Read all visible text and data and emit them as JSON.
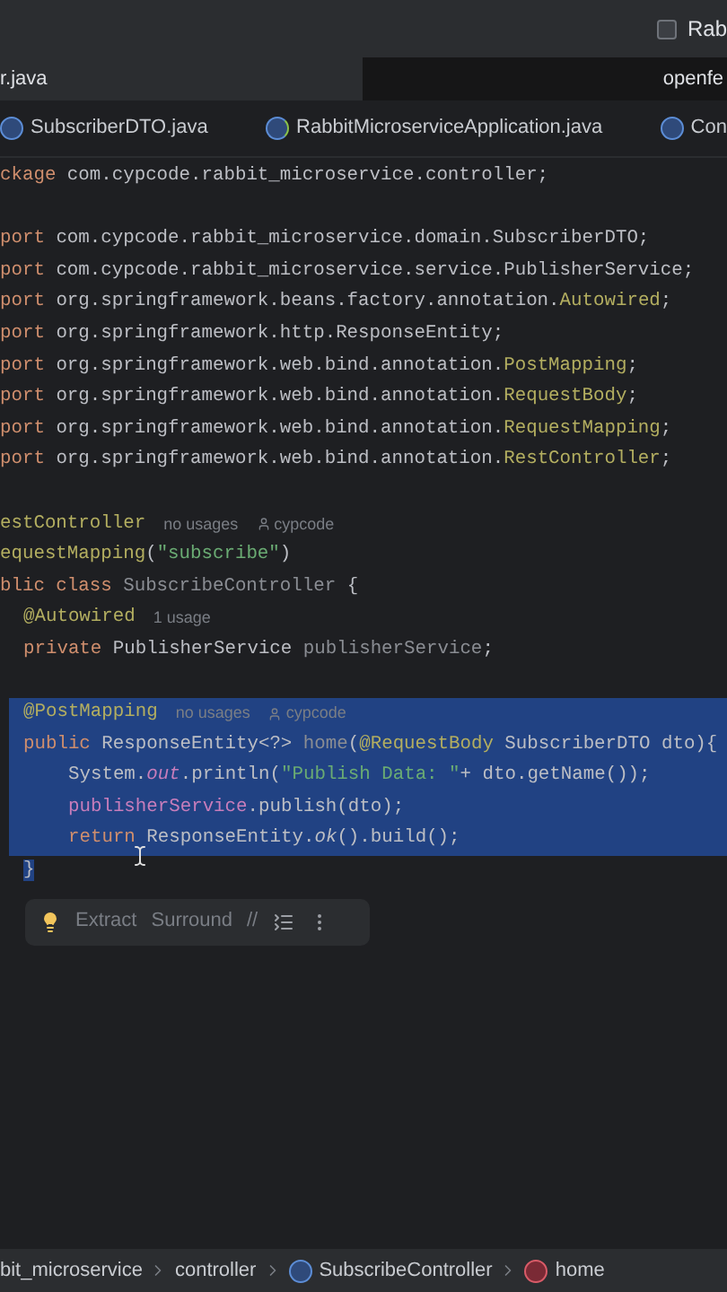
{
  "title_bar": {
    "project": "Rab"
  },
  "editor_tabs": [
    {
      "label": "r.java",
      "selected": true
    },
    {
      "label": "openfe",
      "selected": false
    }
  ],
  "file_tabs": [
    {
      "label": "SubscriberDTO.java",
      "kind": "class"
    },
    {
      "label": "RabbitMicroserviceApplication.java",
      "kind": "app"
    },
    {
      "label": "Con",
      "kind": "class"
    }
  ],
  "code_lines": [
    {
      "kind": "top",
      "selected": false,
      "code": [
        {
          "kind": "keyword",
          "text": "ckage"
        },
        {
          "kind": "plain",
          "text": " com.cypcode.rabbit_microservice.controller;"
        }
      ]
    },
    {
      "kind": "blank",
      "selected": false
    },
    {
      "kind": "top",
      "selected": false,
      "code": [
        {
          "kind": "keyword",
          "text": "port"
        },
        {
          "kind": "plain",
          "text": " com.cypcode.rabbit_microservice.domain.SubscriberDTO;"
        }
      ]
    },
    {
      "kind": "top",
      "selected": false,
      "code": [
        {
          "kind": "keyword",
          "text": "port"
        },
        {
          "kind": "plain",
          "text": " com.cypcode.rabbit_microservice.service.PublisherService;"
        }
      ]
    },
    {
      "kind": "top",
      "selected": false,
      "code": [
        {
          "kind": "keyword",
          "text": "port"
        },
        {
          "kind": "plain",
          "text": " org.springframework.beans.factory.annotation."
        },
        {
          "kind": "annotation",
          "text": "Autowired"
        },
        {
          "kind": "plain",
          "text": ";"
        }
      ]
    },
    {
      "kind": "top",
      "selected": false,
      "code": [
        {
          "kind": "keyword",
          "text": "port"
        },
        {
          "kind": "plain",
          "text": " org.springframework.http.ResponseEntity;"
        }
      ]
    },
    {
      "kind": "top",
      "selected": false,
      "code": [
        {
          "kind": "keyword",
          "text": "port"
        },
        {
          "kind": "plain",
          "text": " org.springframework.web.bind.annotation."
        },
        {
          "kind": "annotation",
          "text": "PostMapping"
        },
        {
          "kind": "plain",
          "text": ";"
        }
      ]
    },
    {
      "kind": "top",
      "selected": false,
      "code": [
        {
          "kind": "keyword",
          "text": "port"
        },
        {
          "kind": "plain",
          "text": " org.springframework.web.bind.annotation."
        },
        {
          "kind": "annotation",
          "text": "RequestBody"
        },
        {
          "kind": "plain",
          "text": ";"
        }
      ]
    },
    {
      "kind": "top",
      "selected": false,
      "code": [
        {
          "kind": "keyword",
          "text": "port"
        },
        {
          "kind": "plain",
          "text": " org.springframework.web.bind.annotation."
        },
        {
          "kind": "annotation",
          "text": "RequestMapping"
        },
        {
          "kind": "plain",
          "text": ";"
        }
      ]
    },
    {
      "kind": "top",
      "selected": false,
      "code": [
        {
          "kind": "keyword",
          "text": "port"
        },
        {
          "kind": "plain",
          "text": " org.springframework.web.bind.annotation."
        },
        {
          "kind": "annotation",
          "text": "RestController"
        },
        {
          "kind": "plain",
          "text": ";"
        }
      ]
    },
    {
      "kind": "blank",
      "selected": false
    },
    {
      "kind": "top",
      "selected": false,
      "code": [
        {
          "kind": "annotation",
          "text": "estController"
        }
      ],
      "hints": [
        {
          "kind": "usage",
          "text": "no usages"
        },
        {
          "kind": "author",
          "text": "cypcode"
        }
      ]
    },
    {
      "kind": "top",
      "selected": false,
      "code": [
        {
          "kind": "annotation",
          "text": "equestMapping"
        },
        {
          "kind": "plain",
          "text": "("
        },
        {
          "kind": "string",
          "text": "\"subscribe\""
        },
        {
          "kind": "plain",
          "text": ")"
        }
      ]
    },
    {
      "kind": "top",
      "selected": false,
      "code": [
        {
          "kind": "keyword",
          "text": "blic class"
        },
        {
          "kind": "unused",
          "text": " SubscribeController"
        },
        {
          "kind": "plain",
          "text": " {"
        }
      ]
    },
    {
      "kind": "member",
      "selected": false,
      "code": [
        {
          "kind": "annotation",
          "text": "@Autowired"
        }
      ],
      "hints": [
        {
          "kind": "usage",
          "text": "1 usage"
        }
      ]
    },
    {
      "kind": "member",
      "selected": false,
      "code": [
        {
          "kind": "keyword",
          "text": "private"
        },
        {
          "kind": "plain",
          "text": " PublisherService "
        },
        {
          "kind": "unused",
          "text": "publisherService"
        },
        {
          "kind": "plain",
          "text": ";"
        }
      ]
    },
    {
      "kind": "blank",
      "selected": false
    },
    {
      "kind": "member",
      "selected": true,
      "code": [
        {
          "kind": "annotation",
          "text": "@PostMapping"
        }
      ],
      "hints": [
        {
          "kind": "usage",
          "text": "no usages"
        },
        {
          "kind": "author",
          "text": "cypcode"
        }
      ]
    },
    {
      "kind": "member",
      "selected": true,
      "code": [
        {
          "kind": "keyword",
          "text": "public"
        },
        {
          "kind": "plain",
          "text": " ResponseEntity<?> "
        },
        {
          "kind": "unused",
          "text": "home"
        },
        {
          "kind": "plain",
          "text": "("
        },
        {
          "kind": "annotation",
          "text": "@RequestBody"
        },
        {
          "kind": "plain",
          "text": " SubscriberDTO dto){"
        }
      ]
    },
    {
      "kind": "body",
      "selected": true,
      "code": [
        {
          "kind": "plain",
          "text": "System."
        },
        {
          "kind": "static_field",
          "text": "out"
        },
        {
          "kind": "plain",
          "text": ".println("
        },
        {
          "kind": "string",
          "text": "\"Publish Data: \""
        },
        {
          "kind": "plain",
          "text": "+ dto.getName());"
        }
      ]
    },
    {
      "kind": "body",
      "selected": true,
      "code": [
        {
          "kind": "field",
          "text": "publisherService"
        },
        {
          "kind": "plain",
          "text": ".publish(dto);"
        }
      ]
    },
    {
      "kind": "body",
      "selected": true,
      "code": [
        {
          "kind": "keyword",
          "text": "return"
        },
        {
          "kind": "plain",
          "text": " ResponseEntity."
        },
        {
          "kind": "static_method",
          "text": "ok"
        },
        {
          "kind": "plain",
          "text": "().build();"
        }
      ]
    },
    {
      "kind": "member",
      "selected": false,
      "code": [
        {
          "kind": "selected_plain",
          "text": "}"
        }
      ]
    }
  ],
  "action_bar": {
    "items": [
      {
        "kind": "bulb"
      },
      {
        "kind": "text",
        "label": "Extract"
      },
      {
        "kind": "text",
        "label": "Surround"
      },
      {
        "kind": "text",
        "label": "//"
      },
      {
        "kind": "list"
      },
      {
        "kind": "more"
      }
    ]
  },
  "breadcrumbs": [
    {
      "label": "bit_microservice",
      "kind": "package"
    },
    {
      "label": "controller",
      "kind": "package"
    },
    {
      "label": "SubscribeController",
      "kind": "class"
    },
    {
      "label": "home",
      "kind": "method"
    }
  ]
}
